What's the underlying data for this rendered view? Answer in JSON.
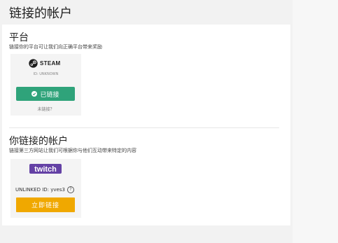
{
  "page": {
    "title": "链接的帐户"
  },
  "platform_section": {
    "title": "平台",
    "subtitle": "链接你的平台可让我们向正确平台带来奖励",
    "steam": {
      "logo_text": "STEAM",
      "id_text": "ID: UNKNOWN",
      "linked_label": "已链接",
      "unlink_label": "未链接？"
    }
  },
  "accounts_section": {
    "title": "你链接的帐户",
    "subtitle": "链接第三方网站让我们可根据你与他们互动带来特定的内容",
    "twitch": {
      "logo_text": "twitch",
      "unlinked_id": "UNLINKED ID: yves3",
      "link_now_label": "立即链接"
    }
  },
  "colors": {
    "linked_green": "#2fa37a",
    "link_orange": "#f0a800",
    "twitch_purple": "#6441a5"
  }
}
